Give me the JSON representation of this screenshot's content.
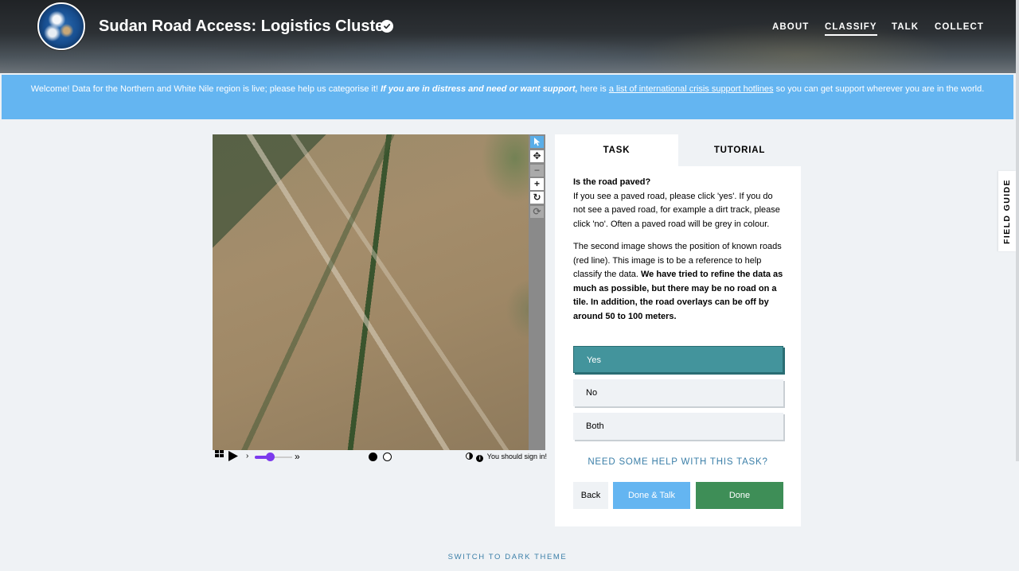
{
  "header": {
    "title": "Sudan Road Access: Logistics Cluster",
    "nav": [
      {
        "label": "ABOUT",
        "active": false
      },
      {
        "label": "CLASSIFY",
        "active": true
      },
      {
        "label": "TALK",
        "active": false
      },
      {
        "label": "COLLECT",
        "active": false
      }
    ]
  },
  "banner": {
    "text_1": "Welcome! Data for the Northern and White Nile region is live; please help us categorise it!",
    "emphasis": "If you are in distress and need or want support,",
    "text_2": "here is",
    "link": "a list of international crisis support hotlines",
    "text_3": "so you can get support wherever you are in the world."
  },
  "viewer": {
    "tools": [
      "pointer-icon",
      "move-icon",
      "zoom-out-icon",
      "zoom-in-icon",
      "rotate-icon",
      "reset-icon"
    ],
    "frame_position": 0.4,
    "signin_text": "You should sign in!"
  },
  "task_panel": {
    "tabs": [
      "TASK",
      "TUTORIAL"
    ],
    "question": "Is the road paved?",
    "instructions": "If you see a paved road, please click 'yes'. If you do not see a paved road, for example a dirt track, please click 'no'. Often a paved road will be grey in colour.",
    "note": "The second image shows the position of known roads (red line). This image is to be a reference to help classify the data.",
    "note_bold": "We have tried to refine the data as much as possible, but there may be no road on a tile. In addition, the road overlays can be off by around 50 to 100 meters.",
    "answers": [
      {
        "label": "Yes",
        "selected": true
      },
      {
        "label": "No",
        "selected": false
      },
      {
        "label": "Both",
        "selected": false
      }
    ],
    "help_link": "NEED SOME HELP WITH THIS TASK?",
    "buttons": {
      "back": "Back",
      "done_talk": "Done & Talk",
      "done": "Done"
    }
  },
  "field_guide": "FIELD GUIDE",
  "footer": {
    "theme_toggle": "SWITCH TO DARK THEME"
  },
  "colors": {
    "accent_blue": "#64b5f1",
    "selected_answer": "#43949c",
    "done_green": "#3e8e57",
    "link": "#3b7fa8"
  }
}
